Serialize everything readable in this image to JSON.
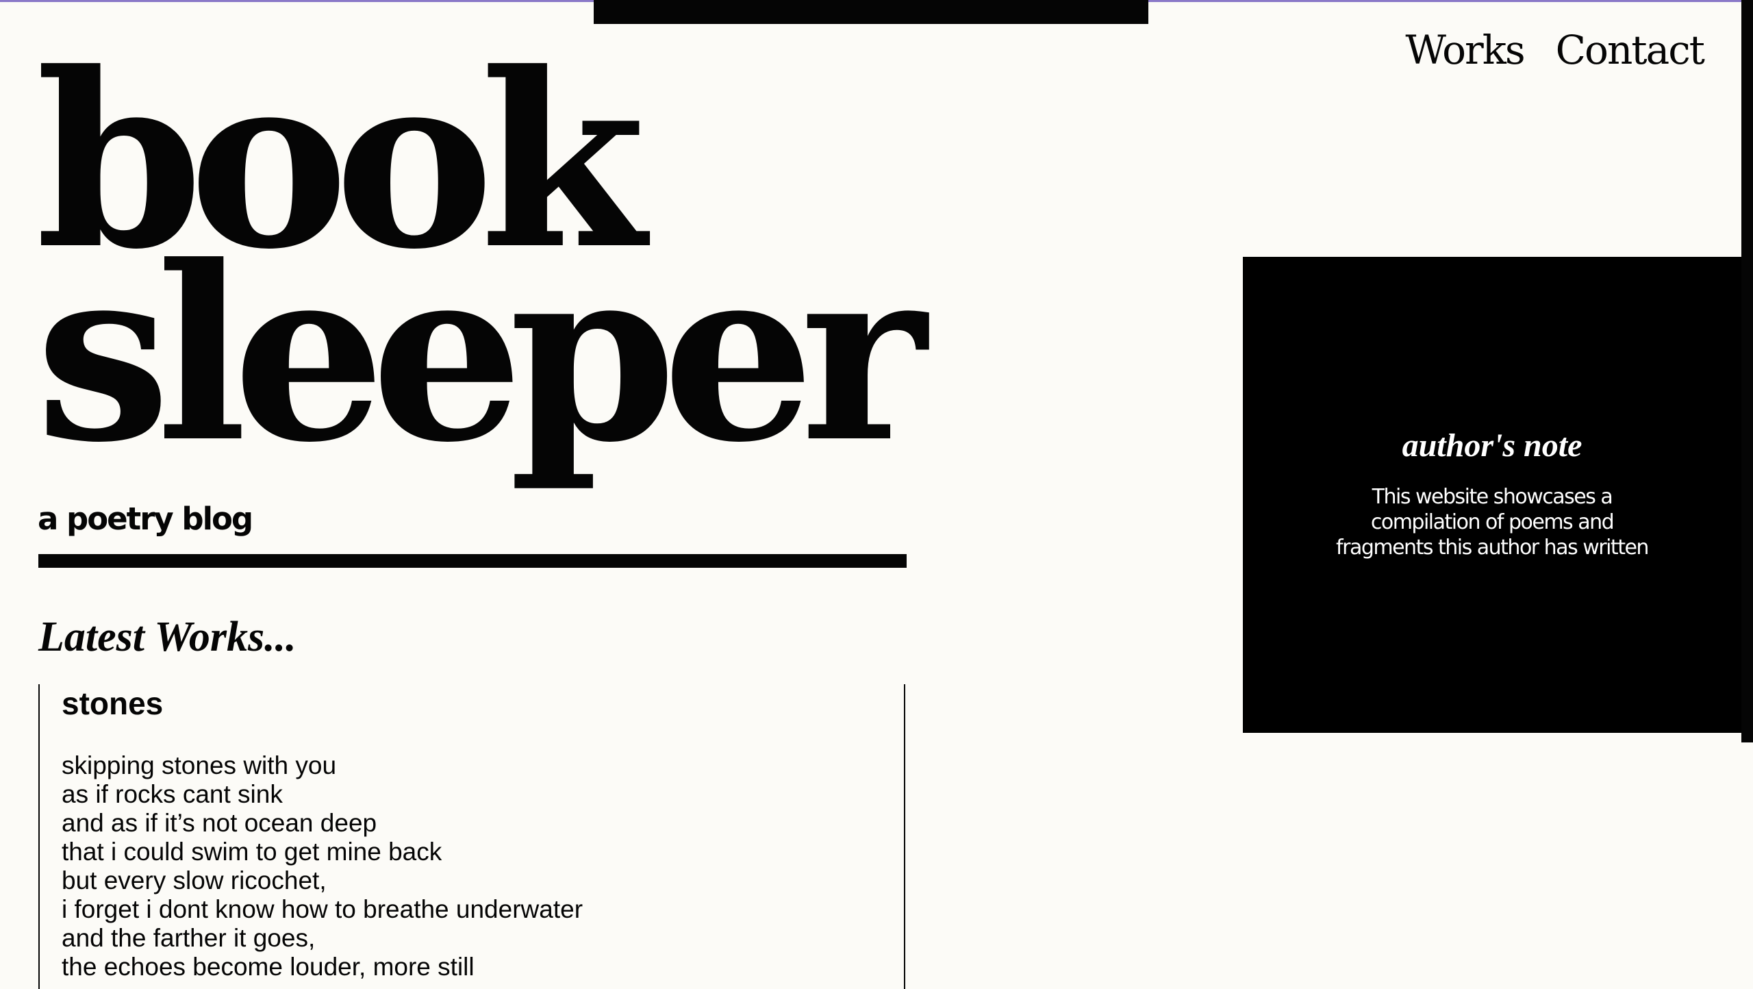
{
  "nav": {
    "items": [
      {
        "label": "Works"
      },
      {
        "label": "Contact"
      }
    ]
  },
  "hero": {
    "title_line1": "book",
    "title_line2": "sleeper",
    "subtitle": "a poetry blog"
  },
  "latest": {
    "heading": "Latest Works..."
  },
  "works": [
    {
      "title": "stones",
      "lines": [
        "skipping stones with you",
        "as if rocks cant sink",
        "and as if it’s not ocean deep",
        "that i could swim to get mine back",
        "but every slow ricochet,",
        "i forget i dont know how to breathe underwater",
        "and the farther it goes,",
        "the echoes become louder, more still"
      ]
    }
  ],
  "author_note": {
    "title": "author's note",
    "body": "This website showcases a compilation of poems and fragments this author has written"
  },
  "colors": {
    "background": "#fcfbf7",
    "ink": "#050505",
    "panel": "#000000",
    "panel_text": "#ffffff",
    "top_accent": "#8a78c8"
  }
}
